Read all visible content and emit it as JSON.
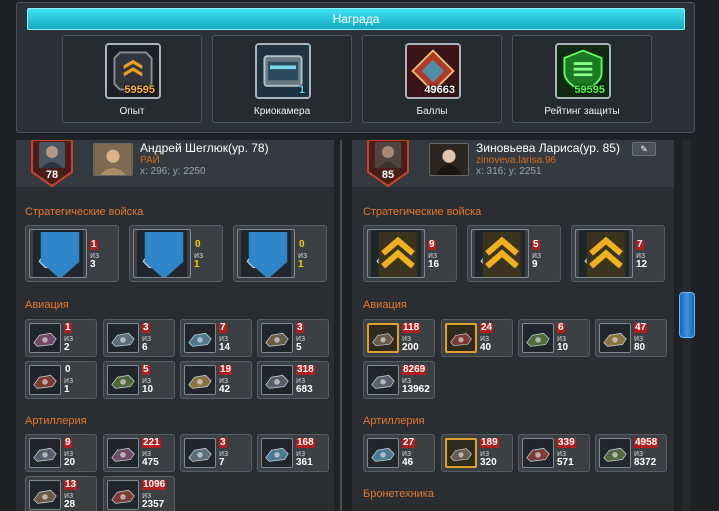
{
  "reward": {
    "title": "Награда",
    "items": [
      {
        "label": "Опыт",
        "count": "59595",
        "count_color": "#ffb23a"
      },
      {
        "label": "Криокамера",
        "count": "1",
        "count_color": "#3ae7ff"
      },
      {
        "label": "Баллы",
        "count": "49663",
        "count_color": "#ffffff"
      },
      {
        "label": "Рейтинг защиты",
        "count": "59595",
        "count_color": "#49ff49"
      }
    ]
  },
  "left": {
    "level": "78",
    "name": "Андрей Шеглюк(ур. 78)",
    "clan": "РАЙ",
    "coords": "x: 296; y: 2250",
    "sections": [
      {
        "title": "Стратегические войска",
        "units": [
          {
            "top": "1",
            "bottom": "3",
            "top_style": "red"
          },
          {
            "top": "0",
            "bottom": "1",
            "top_style": "yellow"
          },
          {
            "top": "0",
            "bottom": "1",
            "top_style": "yellow"
          }
        ]
      },
      {
        "title": "Авиация",
        "units": [
          {
            "top": "1",
            "bottom": "2",
            "top_style": "red"
          },
          {
            "top": "3",
            "bottom": "6",
            "top_style": "red"
          },
          {
            "top": "7",
            "bottom": "14",
            "top_style": "red"
          },
          {
            "top": "3",
            "bottom": "5",
            "top_style": "red"
          },
          {
            "top": "0",
            "bottom": "1",
            "top_style": "white"
          },
          {
            "top": "5",
            "bottom": "10",
            "top_style": "red"
          },
          {
            "top": "19",
            "bottom": "42",
            "top_style": "red"
          },
          {
            "top": "318",
            "bottom": "683",
            "top_style": "red"
          }
        ]
      },
      {
        "title": "Артиллерия",
        "units": [
          {
            "top": "9",
            "bottom": "20",
            "top_style": "red"
          },
          {
            "top": "221",
            "bottom": "475",
            "top_style": "red"
          },
          {
            "top": "3",
            "bottom": "7",
            "top_style": "red"
          },
          {
            "top": "168",
            "bottom": "361",
            "top_style": "red"
          },
          {
            "top": "13",
            "bottom": "28",
            "top_style": "red"
          },
          {
            "top": "1096",
            "bottom": "2357",
            "top_style": "red"
          }
        ]
      }
    ]
  },
  "right": {
    "level": "85",
    "name": "Зиновьева Лариса(ур. 85)",
    "clan": "zinoveva.larisa.96",
    "coords": "x: 316; y: 2251",
    "edit_icon": "pencil-icon",
    "sections": [
      {
        "title": "Стратегические войска",
        "units": [
          {
            "top": "9",
            "bottom": "16",
            "top_style": "red"
          },
          {
            "top": "5",
            "bottom": "9",
            "top_style": "red"
          },
          {
            "top": "7",
            "bottom": "12",
            "top_style": "red"
          }
        ]
      },
      {
        "title": "Авиация",
        "units": [
          {
            "top": "118",
            "bottom": "200",
            "top_style": "red"
          },
          {
            "top": "24",
            "bottom": "40",
            "top_style": "red"
          },
          {
            "top": "6",
            "bottom": "10",
            "top_style": "red"
          },
          {
            "top": "47",
            "bottom": "80",
            "top_style": "red"
          },
          {
            "top": "8269",
            "bottom": "13962",
            "top_style": "red"
          }
        ]
      },
      {
        "title": "Артиллерия",
        "units": [
          {
            "top": "27",
            "bottom": "46",
            "top_style": "red"
          },
          {
            "top": "189",
            "bottom": "320",
            "top_style": "red"
          },
          {
            "top": "339",
            "bottom": "571",
            "top_style": "red"
          },
          {
            "top": "4958",
            "bottom": "8372",
            "top_style": "red"
          }
        ]
      },
      {
        "title": "Бронетехника",
        "units": []
      }
    ]
  },
  "unit_of_label": "из",
  "colors": {
    "accent_cyan": "#26c6dc",
    "section_orange": "#e47731",
    "clan_orange": "#d36b1e",
    "count_red": "#b21e1e",
    "count_yellow": "#f2d400"
  }
}
